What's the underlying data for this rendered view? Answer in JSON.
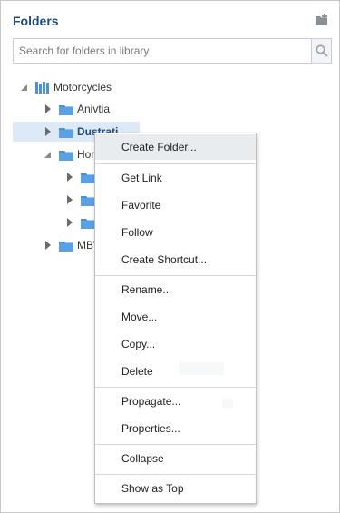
{
  "panel": {
    "title": "Folders",
    "new_folder_icon": "new-folder-icon"
  },
  "search": {
    "placeholder": "Search for folders in library",
    "icon": "search-icon"
  },
  "tree": {
    "root": {
      "label": "Motorcycles",
      "expanded": true
    },
    "items": [
      {
        "label": "Anivtia",
        "selected": false
      },
      {
        "label": "Dustrati",
        "selected": true
      },
      {
        "label": "Hon",
        "expanded": true
      },
      {
        "label": ""
      },
      {
        "label": ""
      },
      {
        "label": ""
      },
      {
        "label": "MBW"
      }
    ]
  },
  "context_menu": {
    "items": [
      "Create Folder...",
      "Get Link",
      "Favorite",
      "Follow",
      "Create Shortcut...",
      "Rename...",
      "Move...",
      "Copy...",
      "Delete",
      "Propagate...",
      "Properties...",
      "Collapse",
      "Show as Top"
    ],
    "highlighted": "Create Folder..."
  },
  "colors": {
    "title": "#1e4d7c",
    "folder": "#4a90d9",
    "selected_row": "#dde9f7"
  }
}
